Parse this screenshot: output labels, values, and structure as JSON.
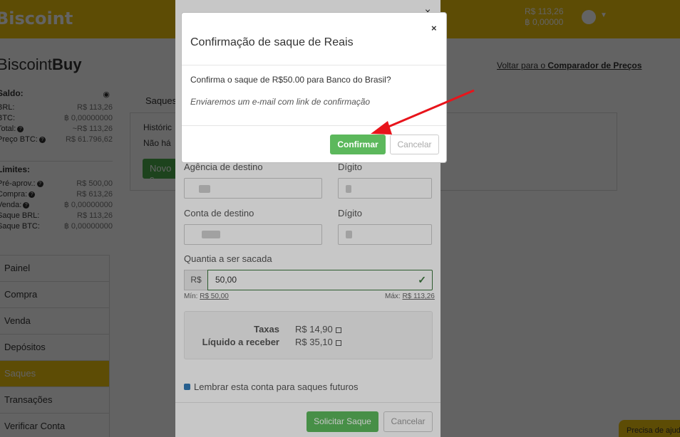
{
  "header": {
    "logo": "Biscoint",
    "balance_brl": "R$ 113,26",
    "balance_btc": "฿ 0,00000"
  },
  "brand": {
    "prefix": "Biscoint",
    "suffix": "Buy"
  },
  "back_link": {
    "prefix": "Voltar para o",
    "bold": "Comparador de Preços"
  },
  "saldo": {
    "title": "Saldo:",
    "rows": [
      {
        "label": "BRL:",
        "value": "R$ 113,26"
      },
      {
        "label": "BTC:",
        "value": "฿ 0,00000000"
      },
      {
        "label": "Total:",
        "value": "~R$ 113,26"
      },
      {
        "label": "Preço BTC:",
        "value": "R$ 61.796,62"
      }
    ]
  },
  "limites": {
    "title": "Limites:",
    "rows": [
      {
        "label": "Pré-aprov.:",
        "value": "R$ 500,00"
      },
      {
        "label": "Compra:",
        "value": "R$ 613,26"
      },
      {
        "label": "Venda:",
        "value": "฿ 0,00000000"
      },
      {
        "label": "Saque BRL:",
        "value": "R$ 113,26"
      },
      {
        "label": "Saque BTC:",
        "value": "฿ 0,00000000"
      }
    ]
  },
  "menu": [
    {
      "label": "Painel"
    },
    {
      "label": "Compra"
    },
    {
      "label": "Venda"
    },
    {
      "label": "Depósitos"
    },
    {
      "label": "Saques",
      "active": true
    },
    {
      "label": "Transações"
    },
    {
      "label": "Verificar Conta"
    }
  ],
  "main": {
    "tab": "Saques",
    "history": "Históric",
    "empty": "Não há",
    "new_btn": "Novo s"
  },
  "withdraw_form": {
    "agency_label": "Agência de destino",
    "digit_label": "Dígito",
    "account_label": "Conta de destino",
    "digit2_label": "Dígito",
    "amount_label": "Quantia a ser sacada",
    "currency_addon": "R$",
    "amount_value": "50,00",
    "min_label": "Mín:",
    "min_value": "R$ 50,00",
    "max_label": "Máx:",
    "max_value": "R$ 113,26",
    "fees_label": "Taxas",
    "fees_value": "R$ 14,90",
    "net_label": "Líquido a receber",
    "net_value": "R$ 35,10",
    "remember_label": "Lembrar esta conta para saques futuros",
    "submit_label": "Solicitar Saque",
    "cancel_label": "Cancelar",
    "close_glyph": "×"
  },
  "confirm_modal": {
    "title": "Confirmação de saque de Reais",
    "close_glyph": "×",
    "message": "Confirma o saque de R$50.00 para Banco do Brasil?",
    "note": "Enviaremos um e-mail com link de confirmação",
    "confirm_label": "Confirmar",
    "cancel_label": "Cancelar"
  },
  "help": {
    "label": "Precisa de ajuda?"
  },
  "colors": {
    "brand_yellow": "#f1c40f",
    "success": "#5cb85c",
    "arrow": "#e8141b"
  }
}
